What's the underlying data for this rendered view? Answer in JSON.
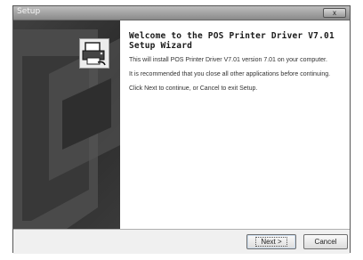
{
  "window": {
    "title": "Setup",
    "close_label": "x"
  },
  "welcome": {
    "heading_line1": "Welcome to the POS Printer Driver V7.01",
    "heading_line2": "Setup Wizard",
    "para1": "This will install POS Printer Driver V7.01 version 7.01 on your computer.",
    "para2": "It is recommended that you close all other applications before continuing.",
    "para3": "Click Next to continue, or Cancel to exit Setup."
  },
  "buttons": {
    "next_label": "Next >",
    "cancel_label": "Cancel"
  },
  "icons": {
    "product": "printer-setup-icon",
    "side_graphic": "wizard-banner-graphic"
  }
}
